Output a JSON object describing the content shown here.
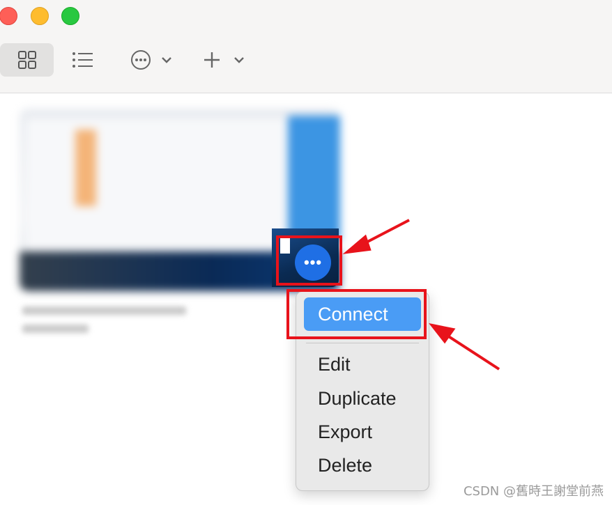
{
  "toolbar": {
    "view_grid": "grid-view-icon",
    "view_list": "list-view-icon",
    "actions": "more-options-icon",
    "add": "add-icon"
  },
  "tile": {
    "actions_button_label": "•••"
  },
  "context_menu": {
    "items": [
      "Connect",
      "Edit",
      "Duplicate",
      "Export",
      "Delete"
    ],
    "highlight_color": "#4a9cf5"
  },
  "annotations": {
    "box_color": "#e8131b"
  },
  "watermark": "CSDN @舊時王謝堂前燕"
}
